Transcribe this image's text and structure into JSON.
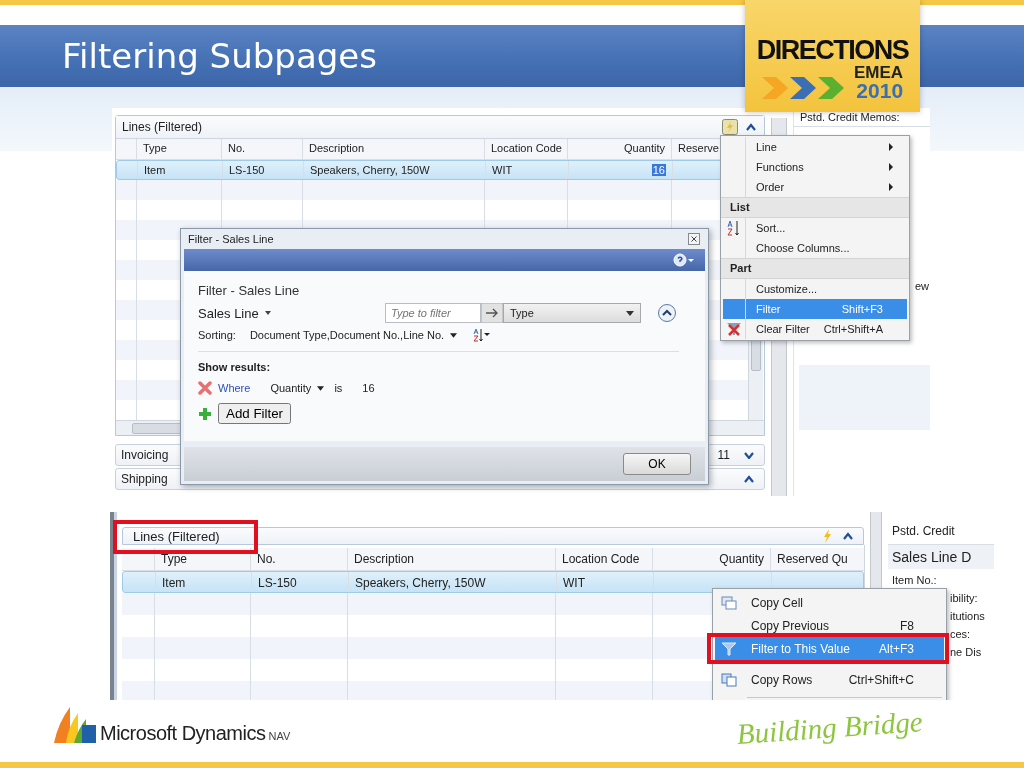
{
  "slide": {
    "title": "Filtering Subpages"
  },
  "badge": {
    "line1": "DIRECTIONS",
    "line2": "EMEA",
    "line3": "2010"
  },
  "top_screenshot": {
    "panel_title": "Lines (Filtered)",
    "columns": [
      "Type",
      "No.",
      "Description",
      "Location Code",
      "Quantity",
      "Reserve"
    ],
    "rows": [
      {
        "cells": [
          "Item",
          "LS-150",
          "Speakers, Cherry, 150W",
          "WIT",
          "16",
          ""
        ],
        "selected": true
      }
    ],
    "sections": [
      {
        "label": "Invoicing",
        "trailing": "11",
        "expanded": false
      },
      {
        "label": "Shipping",
        "expanded": true
      }
    ],
    "side_panel": {
      "label": "Pstd. Credit Memos:",
      "fragment": "ew"
    },
    "filter_dialog": {
      "title": "Filter - Sales Line",
      "heading": "Filter - Sales Line",
      "table_selector": "Sales Line",
      "search_placeholder": "Type to filter",
      "field": "Type",
      "sorting_label": "Sorting:",
      "sorting_value": "Document Type,Document No.,Line No.",
      "show_results": "Show results:",
      "filters": [
        {
          "where": "Where",
          "field": "Quantity",
          "operator": "is",
          "value": "16"
        }
      ],
      "add_filter": "Add Filter",
      "ok": "OK"
    },
    "actions_menu": [
      {
        "kind": "item",
        "label": "Line",
        "submenu": true,
        "selected": false
      },
      {
        "kind": "item",
        "label": "Functions",
        "submenu": true,
        "selected": false
      },
      {
        "kind": "item",
        "label": "Order",
        "submenu": true,
        "selected": false
      },
      {
        "kind": "header",
        "label": "List"
      },
      {
        "kind": "item",
        "label": "Sort...",
        "selected": false
      },
      {
        "kind": "item",
        "label": "Choose Columns...",
        "selected": false
      },
      {
        "kind": "header",
        "label": "Part"
      },
      {
        "kind": "item",
        "label": "Customize...",
        "selected": false
      },
      {
        "kind": "item",
        "label": "Filter",
        "shortcut": "Shift+F3",
        "selected": true
      },
      {
        "kind": "item",
        "label": "Clear Filter",
        "shortcut": "Ctrl+Shift+A",
        "selected": false
      }
    ]
  },
  "bottom_screenshot": {
    "panel_title": "Lines (Filtered)",
    "panel_title_highlighted": true,
    "columns": [
      "Type",
      "No.",
      "Description",
      "Location Code",
      "Quantity",
      "Reserved Qu"
    ],
    "rows": [
      {
        "cells": [
          "Item",
          "LS-150",
          "Speakers, Cherry, 150W",
          "WIT",
          "",
          ""
        ],
        "selected": true
      }
    ],
    "side_panel": {
      "label": "Pstd. Credit",
      "heading": "Sales Line D",
      "fields": [
        "Item No.:",
        "ibility:",
        "itutions",
        "ces:",
        "ne Dis"
      ]
    },
    "context_menu": [
      {
        "label": "Copy Cell",
        "selected": false,
        "highlighted": false
      },
      {
        "label": "Copy Previous",
        "shortcut": "F8",
        "selected": false,
        "highlighted": false
      },
      {
        "label": "Filter to This Value",
        "shortcut": "Alt+F3",
        "selected": true,
        "highlighted": true
      },
      {
        "label": "Copy Rows",
        "shortcut": "Ctrl+Shift+C",
        "selected": false,
        "highlighted": false
      }
    ]
  },
  "footer": {
    "brand": "Microsoft Dynamics",
    "product": "NAV",
    "tagline": "Building Bridge"
  }
}
